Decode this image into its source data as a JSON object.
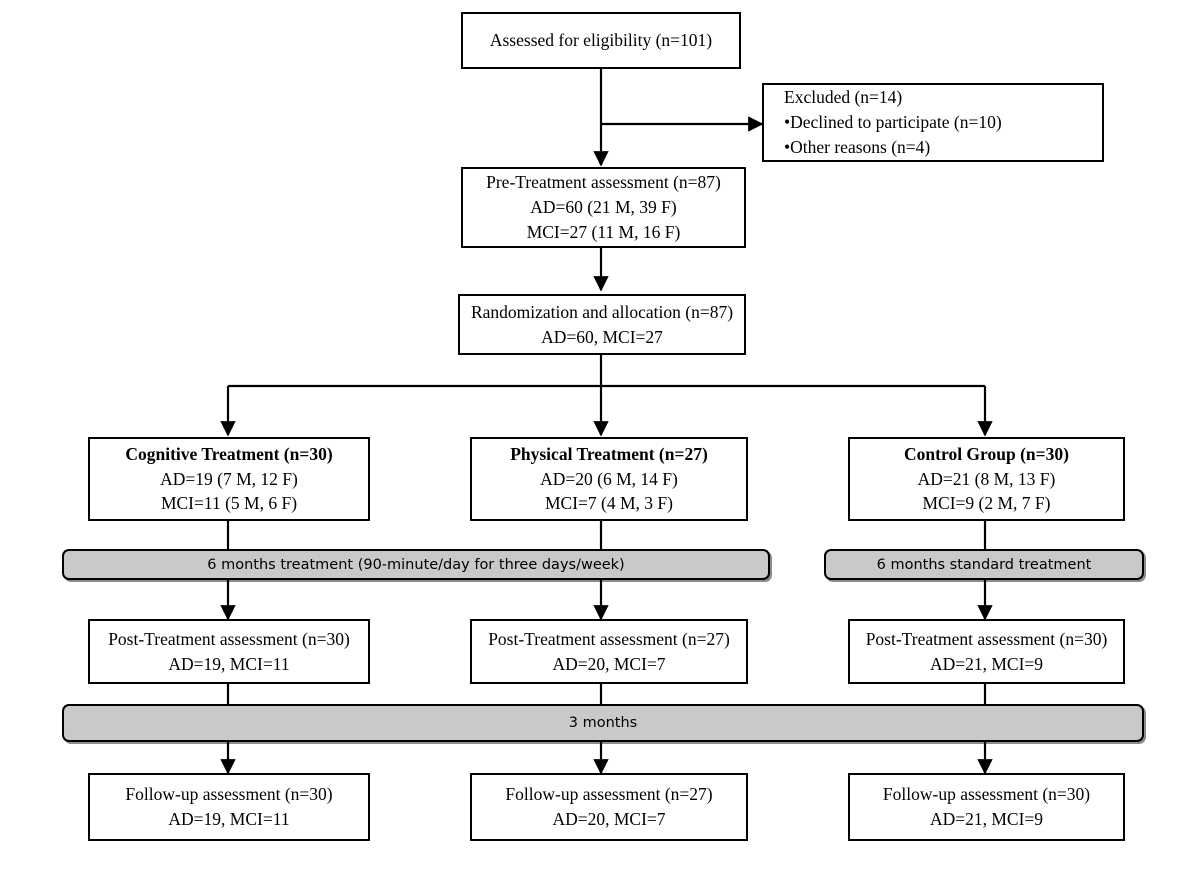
{
  "diagram": {
    "title": "CONSORT participant flow diagram",
    "colors": {
      "box_border": "#000000",
      "box_fill": "#ffffff",
      "bar_fill": "#c9c9c9",
      "text": "#000000"
    }
  },
  "nodes": {
    "eligibility": {
      "line1": "Assessed for eligibility (n=101)"
    },
    "excluded": {
      "line1": "Excluded  (n=14)",
      "line2": "•Declined to participate (n=10)",
      "line3": "•Other reasons (n=4)"
    },
    "pre_treatment": {
      "line1": "Pre-Treatment assessment  (n=87)",
      "line2": "AD=60 (21 M, 39 F)",
      "line3": "MCI=27 (11 M, 16 F)"
    },
    "randomization": {
      "line1": "Randomization and allocation (n=87)",
      "line2": "AD=60, MCI=27"
    },
    "cognitive_group": {
      "line1": "Cognitive Treatment (n=30)",
      "line2": "AD=19 (7 M, 12 F)",
      "line3": "MCI=11 (5 M, 6 F)"
    },
    "physical_group": {
      "line1": "Physical Treatment (n=27)",
      "line2": "AD=20 (6 M, 14 F)",
      "line3": "MCI=7 (4 M, 3 F)"
    },
    "control_group": {
      "line1": "Control Group (n=30)",
      "line2": "AD=21 (8 M, 13 F)",
      "line3": "MCI=9 (2 M, 7 F)"
    },
    "treatment_bar": {
      "label": "6 months treatment (90-minute/day for three days/week)"
    },
    "standard_bar": {
      "label": "6 months standard treatment"
    },
    "post_cognitive": {
      "line1": "Post-Treatment assessment (n=30)",
      "line2": "AD=19, MCI=11"
    },
    "post_physical": {
      "line1": "Post-Treatment assessment (n=27)",
      "line2": "AD=20, MCI=7"
    },
    "post_control": {
      "line1": "Post-Treatment assessment (n=30)",
      "line2": "AD=21, MCI=9"
    },
    "months_bar": {
      "label": "3 months"
    },
    "followup_cognitive": {
      "line1": "Follow-up assessment (n=30)",
      "line2": "AD=19, MCI=11"
    },
    "followup_physical": {
      "line1": "Follow-up assessment (n=27)",
      "line2": "AD=20, MCI=7"
    },
    "followup_control": {
      "line1": "Follow-up assessment (n=30)",
      "line2": "AD=21, MCI=9"
    }
  }
}
